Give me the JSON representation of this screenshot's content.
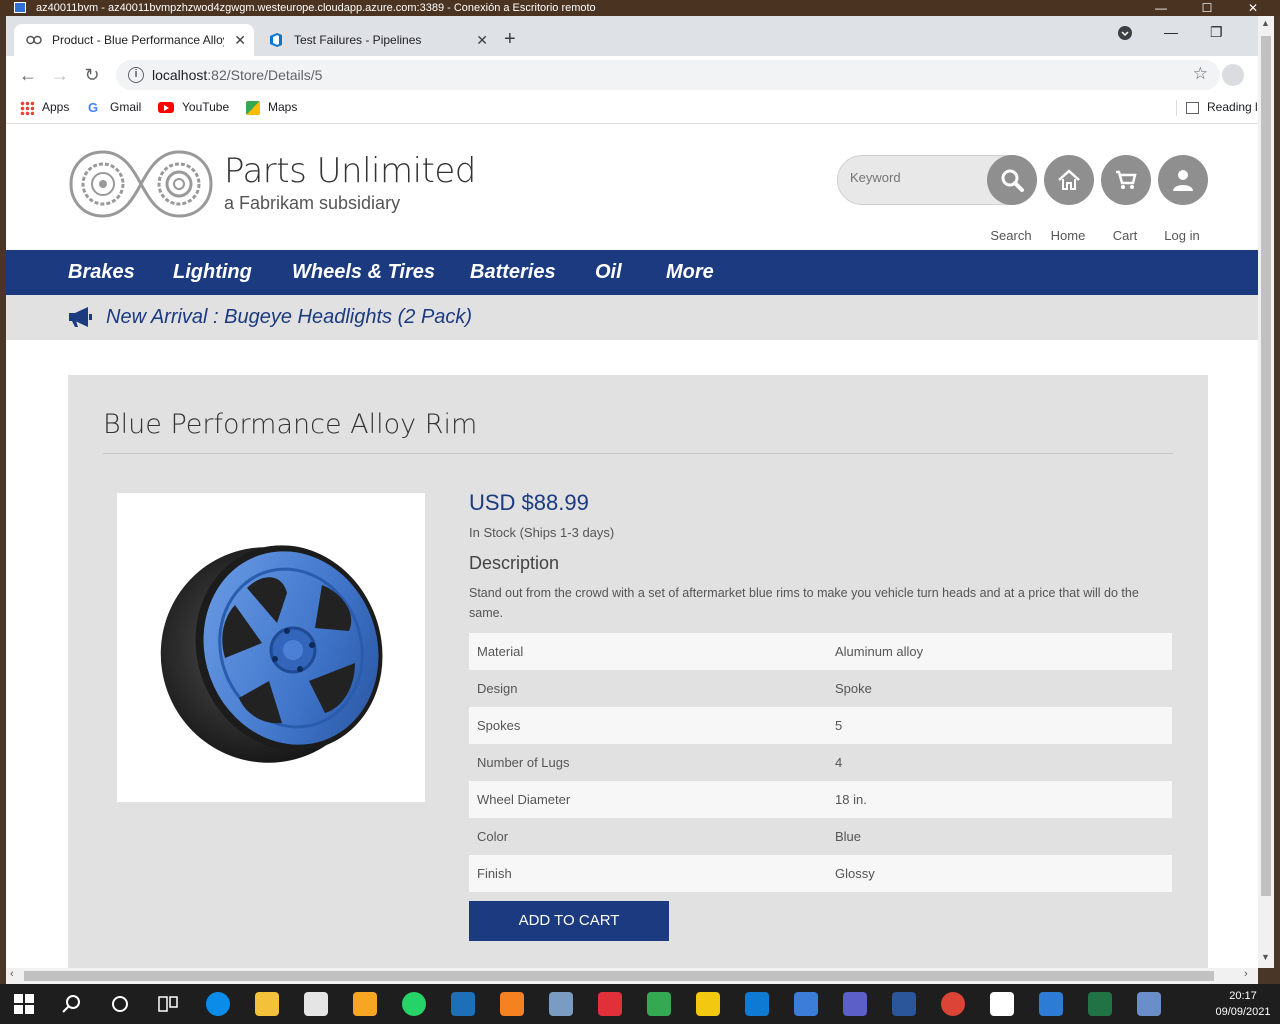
{
  "rdp": {
    "title": "az40011bvm - az40011bvmpzhzwod4zgwgm.westeurope.cloudapp.azure.com:3389 - Conexión a Escritorio remoto",
    "minimize": "—",
    "restore": "☐",
    "close": "✕"
  },
  "browser": {
    "tabs": [
      {
        "title": "Product - Blue Performance Alloy Rim",
        "close": "✕",
        "active": true
      },
      {
        "title": "Test Failures - Pipelines",
        "close": "✕",
        "active": false
      }
    ],
    "new_tab": "+",
    "url_host": "localhost",
    "url_rest": ":82/Store/Details/5",
    "bookmarks": [
      {
        "label": "Apps",
        "icon": "apps-grid-icon"
      },
      {
        "label": "Gmail",
        "icon": "google-icon"
      },
      {
        "label": "YouTube",
        "icon": "youtube-icon"
      },
      {
        "label": "Maps",
        "icon": "maps-icon"
      }
    ],
    "reading_list": "Reading l"
  },
  "site": {
    "brand": "Parts Unlimited",
    "subtitle": "a Fabrikam subsidiary",
    "search_placeholder": "Keyword",
    "actions": {
      "search": "Search",
      "home": "Home",
      "cart": "Cart",
      "login": "Log in"
    },
    "nav": [
      "Brakes",
      "Lighting",
      "Wheels & Tires",
      "Batteries",
      "Oil",
      "More"
    ],
    "promo": "New Arrival : Bugeye Headlights (2 Pack)",
    "colors": {
      "brand_blue": "#1b3a80",
      "panel_gray": "#e1e1e1",
      "icon_gray": "#8f8f8f"
    }
  },
  "product": {
    "title": "Blue Performance Alloy Rim",
    "price": "USD $88.99",
    "stock": "In Stock (Ships 1-3 days)",
    "description_heading": "Description",
    "description": "Stand out from the crowd with a set of aftermarket blue rims to make you vehicle turn heads and at a price that will do the same.",
    "specs": [
      {
        "key": "Material",
        "value": "Aluminum alloy"
      },
      {
        "key": "Design",
        "value": "Spoke"
      },
      {
        "key": "Spokes",
        "value": "5"
      },
      {
        "key": "Number of Lugs",
        "value": "4"
      },
      {
        "key": "Wheel Diameter",
        "value": "18 in."
      },
      {
        "key": "Color",
        "value": "Blue"
      },
      {
        "key": "Finish",
        "value": "Glossy"
      }
    ],
    "add_to_cart": "ADD TO CART"
  },
  "taskbar": {
    "time": "20:17",
    "date": "09/09/2021"
  }
}
